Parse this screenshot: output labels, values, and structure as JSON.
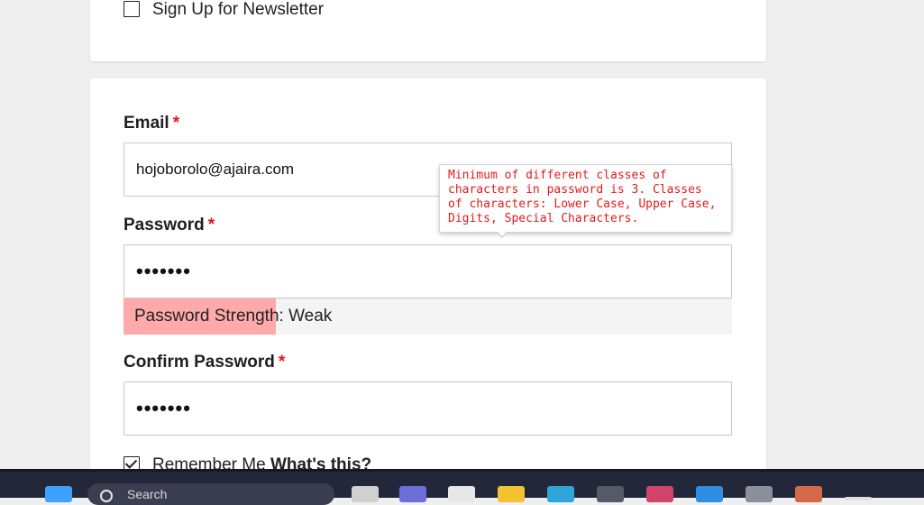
{
  "newsletter": {
    "label": "Sign Up for Newsletter",
    "checked": false
  },
  "email": {
    "label": "Email",
    "required_mark": "*",
    "value": "hojoborolo@ajaira.com"
  },
  "password": {
    "label": "Password",
    "required_mark": "*",
    "value": "•••••••"
  },
  "strength": {
    "text": "Password Strength: Weak",
    "level_fraction": 0.25,
    "fill_color": "#ffaaaa"
  },
  "tooltip": {
    "text": "Minimum of different classes of characters in password is 3. Classes of characters: Lower Case, Upper Case, Digits, Special Characters."
  },
  "confirm_password": {
    "label": "Confirm Password",
    "required_mark": "*",
    "value": "•••••••"
  },
  "remember": {
    "label": "Remember Me",
    "link": "What's this?",
    "checked": true
  },
  "taskbar": {
    "search_placeholder": "Search"
  },
  "colors": {
    "required": "#e0161b",
    "tooltip_text": "#e31b1b",
    "taskbar": "#23273a"
  }
}
